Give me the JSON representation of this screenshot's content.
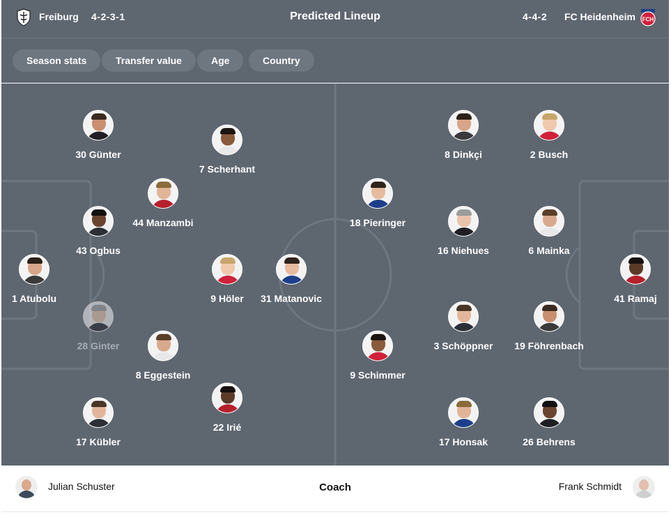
{
  "header": {
    "title": "Predicted Lineup",
    "home": {
      "name": "Freiburg",
      "formation": "4-2-3-1",
      "crest_icon": "freiburg-crest-icon"
    },
    "away": {
      "name": "FC Heidenheim",
      "formation": "4-4-2",
      "crest_icon": "heidenheim-crest-icon",
      "crest_text": "FCH",
      "crest_color": "#d0213a"
    }
  },
  "filters": [
    "Season stats",
    "Transfer value",
    "Age",
    "Country"
  ],
  "home_players": [
    {
      "label": "30 Günter"
    },
    {
      "label": "7 Scherhant"
    },
    {
      "label": "44 Manzambi"
    },
    {
      "label": "43 Ogbus"
    },
    {
      "label": "1 Atubolu"
    },
    {
      "label": "9 Höler"
    },
    {
      "label": "31 Matanovic"
    },
    {
      "label": "28 Ginter",
      "faded": true
    },
    {
      "label": "8 Eggestein"
    },
    {
      "label": "22 Irié"
    },
    {
      "label": "17 Kübler"
    }
  ],
  "away_players": [
    {
      "label": "8 Dinkçi"
    },
    {
      "label": "2 Busch"
    },
    {
      "label": "18 Pieringer"
    },
    {
      "label": "16 Niehues"
    },
    {
      "label": "6 Mainka"
    },
    {
      "label": "41 Ramaj"
    },
    {
      "label": "3 Schöppner"
    },
    {
      "label": "19 Föhrenbach"
    },
    {
      "label": "9 Schimmer"
    },
    {
      "label": "17 Honsak"
    },
    {
      "label": "26 Behrens"
    }
  ],
  "coach": {
    "title": "Coach",
    "home": "Julian Schuster",
    "away": "Frank Schmidt"
  },
  "colors": {
    "pitch": "#5e6670",
    "lines": "#6e7680",
    "text": "#ffffff"
  }
}
